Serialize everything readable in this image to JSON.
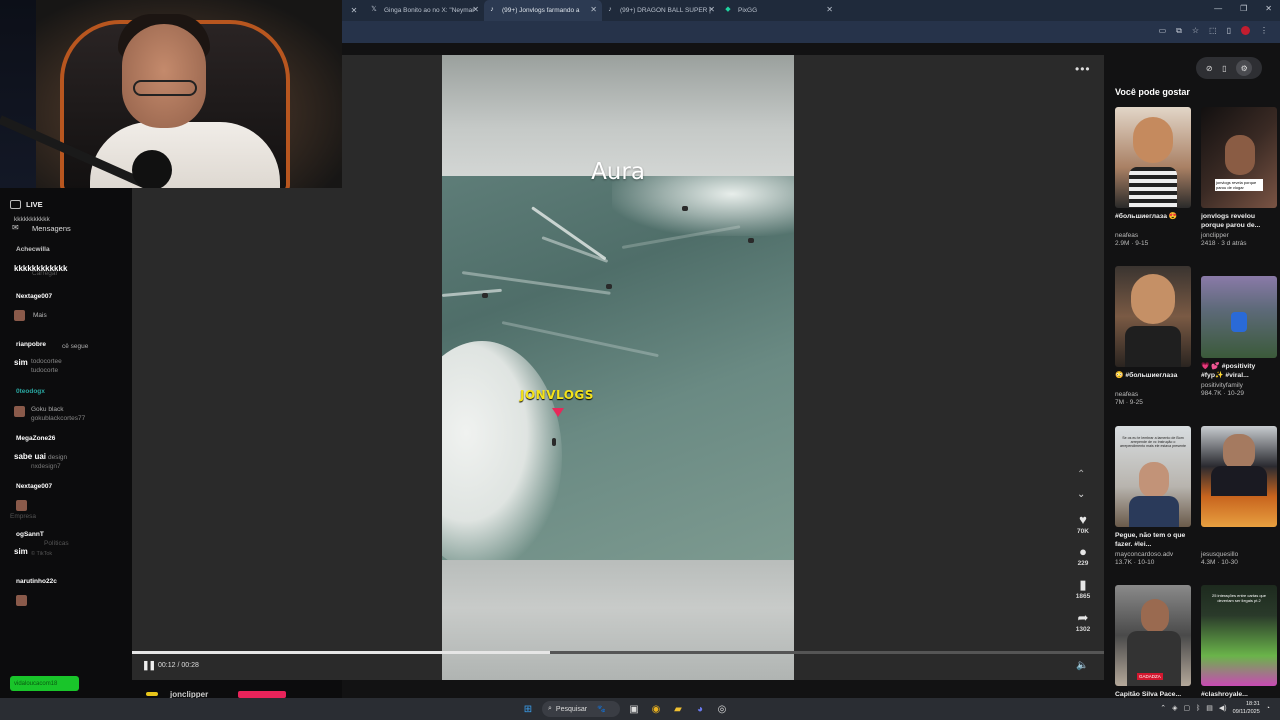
{
  "browser": {
    "tabs": [
      {
        "label": "Ginga Bonito ao no X: \"Neymar",
        "icon": "x-logo-icon",
        "active": false
      },
      {
        "label": "(99+) Jonvlogs farmando a",
        "icon": "tiktok-icon",
        "active": true
      },
      {
        "label": "(99+) DRAGON BALL SUPER |",
        "icon": "tiktok-icon",
        "active": false
      },
      {
        "label": "PixGG",
        "icon": "pixgg-icon",
        "active": false
      }
    ]
  },
  "video": {
    "caption": "Aura",
    "watermark": "JONVLOGS",
    "time": "00:12 / 00:28",
    "progress": 0.43,
    "actions": [
      {
        "name": "like",
        "icon": "heart-icon",
        "count": "70K"
      },
      {
        "name": "comment",
        "icon": "comment-icon",
        "count": "229"
      },
      {
        "name": "save",
        "icon": "bookmark-icon",
        "count": "1865"
      },
      {
        "name": "share",
        "icon": "share-icon",
        "count": "1302"
      }
    ],
    "author": "jonclipper"
  },
  "sidebar": {
    "title": "Você pode gostar",
    "items": [
      {
        "title": "#большиеглаза 😍",
        "author": "neafeas",
        "stats": "2.9M · 9-15",
        "colors": [
          "#d9c6b4",
          "#9a6a4c"
        ]
      },
      {
        "title": "jonvlogs revelou porque parou de...",
        "author": "jonclipper",
        "stats": "2418 · 3 d atrás",
        "colors": [
          "#1a1414",
          "#6e4a3a"
        ]
      },
      {
        "title": "😳 #большиеглаза",
        "author": "neafeas",
        "stats": "7M · 9-25",
        "colors": [
          "#3b3530",
          "#9a7452"
        ]
      },
      {
        "title": "💗 💕 #positivity #fyp✨ #viral...",
        "author": "positivityfamily",
        "stats": "984.7K · 10-29",
        "colors": [
          "#6a5a8a",
          "#3d5a3a"
        ]
      },
      {
        "title": "Pegue, não tem o que fazer. #lei...",
        "author": "mayconcardoso.adv",
        "stats": "13.7K · 10-10",
        "colors": [
          "#cfd4d8",
          "#7a6a5a"
        ]
      },
      {
        "title": "",
        "author": "jesusquesillo",
        "stats": "4.3M · 10-30",
        "colors": [
          "#2a2a2e",
          "#c8641e"
        ]
      },
      {
        "title": "Capitão Silva Pace...",
        "author": "",
        "stats": "",
        "colors": [
          "#4a4a4a",
          "#b4a89a"
        ]
      },
      {
        "title": "#clashroyale...",
        "author": "",
        "stats": "",
        "colors": [
          "#1d2a1e",
          "#6ab44a"
        ]
      }
    ],
    "thumb_texts": {
      "jonvlogs": "jonvlogs revela porque parou de vlogar",
      "lawyer": "Se os eu te lembrar a lamento de Bom arrepende de vc Instrução o arrependimento mais ele estava presente",
      "clash": "25 interações entre cartas que deveriam ser ilegais pt.2",
      "police": "GADADZA"
    }
  },
  "stream": {
    "live_label": "LIVE",
    "chat": [
      {
        "type": "faint",
        "text": "kkkkkkkkkkk"
      },
      {
        "type": "faint",
        "text": "Mensagens"
      },
      {
        "type": "pill",
        "name": "Achecwilla",
        "color": "#b9793a"
      },
      {
        "type": "msg",
        "text": "kkkkkkkkkkkk"
      },
      {
        "type": "faint",
        "text": "Carregar"
      },
      {
        "type": "pill",
        "name": "Nextage007",
        "color": "#d4172f"
      },
      {
        "type": "faint",
        "text": "Mais"
      },
      {
        "type": "pill",
        "name": "rianpobre",
        "color": "#f19a0a"
      },
      {
        "type": "faint",
        "text": "cê segue"
      },
      {
        "type": "msg",
        "text": "sim"
      },
      {
        "type": "faint",
        "text": "todocortee"
      },
      {
        "type": "faint",
        "text": "tudocorte"
      },
      {
        "type": "pill",
        "name": "0teodogx",
        "color": "#6ee3dc"
      },
      {
        "type": "faint",
        "text": "Goku black"
      },
      {
        "type": "faint",
        "text": "gokublackcortes77"
      },
      {
        "type": "pill",
        "name": "MegaZone26",
        "color": "#d4172f"
      },
      {
        "type": "msg",
        "text": "sabe uai"
      },
      {
        "type": "faint",
        "text": "design"
      },
      {
        "type": "faint",
        "text": "nxdesign7"
      },
      {
        "type": "pill",
        "name": "Nextage007",
        "color": "#d4172f"
      },
      {
        "type": "faint",
        "text": "Empresa"
      },
      {
        "type": "pill",
        "name": "ogSannT",
        "color": "#1e7fd8"
      },
      {
        "type": "faint",
        "text": "Políticas"
      },
      {
        "type": "msg",
        "text": "sim"
      },
      {
        "type": "faint",
        "text": "© TikTok"
      },
      {
        "type": "pill",
        "name": "narutinho22c",
        "color": "#d4172f"
      },
      {
        "type": "pill",
        "name": "vidaloucacom18",
        "color": "#19c52a"
      }
    ]
  },
  "taskbar": {
    "search_placeholder": "Pesquisar",
    "time": "18:31",
    "date": "09/11/2025"
  }
}
